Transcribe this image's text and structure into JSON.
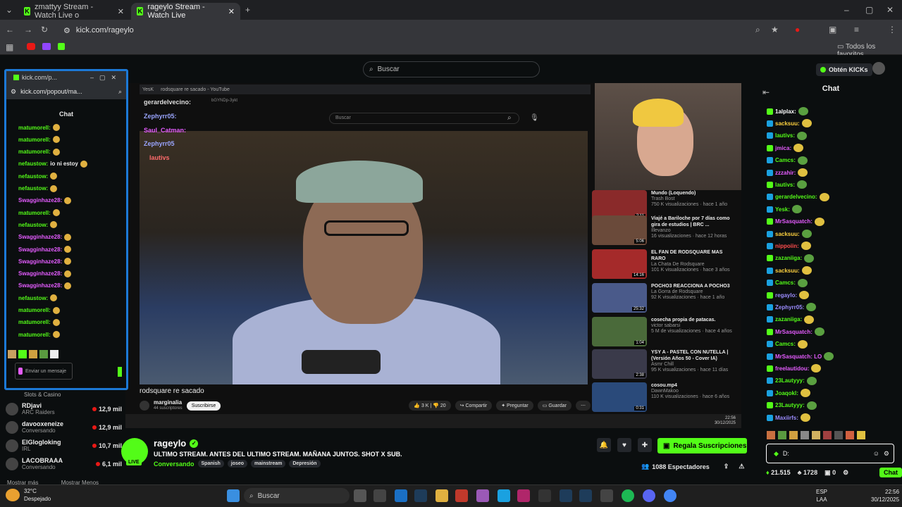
{
  "browser": {
    "tabs": [
      {
        "label": "zmattyy Stream - Watch Live o",
        "active": false
      },
      {
        "label": "rageylo Stream - Watch Live",
        "active": true
      }
    ],
    "url": "kick.com/rageylo",
    "bookmarks_label": "Todos los favoritos"
  },
  "kick": {
    "search_placeholder": "Buscar",
    "obtain_kicks": "Obtén KICKs",
    "chat_title": "Chat"
  },
  "popout": {
    "window_title": "kick.com/p...",
    "url": "kick.com/popout/ma...",
    "chat_label": "Chat",
    "input_placeholder": "Enviar un mensaje",
    "messages": [
      {
        "user": "matumorell:",
        "text": "",
        "color": "green"
      },
      {
        "user": "matumorell:",
        "text": "",
        "color": "green"
      },
      {
        "user": "matumorell:",
        "text": "",
        "color": "green"
      },
      {
        "user": "nefaustow:",
        "text": "io ni estoy",
        "color": "green"
      },
      {
        "user": "nefaustow:",
        "text": "",
        "color": "green"
      },
      {
        "user": "nefaustow:",
        "text": "",
        "color": "green"
      },
      {
        "user": "Swagginhaze28:",
        "text": "",
        "color": "pink"
      },
      {
        "user": "matumorell:",
        "text": "",
        "color": "green"
      },
      {
        "user": "nefaustow:",
        "text": "",
        "color": "green"
      },
      {
        "user": "Swagginhaze28:",
        "text": "",
        "color": "pink"
      },
      {
        "user": "Swagginhaze28:",
        "text": "",
        "color": "pink"
      },
      {
        "user": "Swagginhaze28:",
        "text": "",
        "color": "pink"
      },
      {
        "user": "Swagginhaze28:",
        "text": "",
        "color": "pink"
      },
      {
        "user": "Swagginhaze28:",
        "text": "",
        "color": "pink"
      },
      {
        "user": "nefaustow:",
        "text": "",
        "color": "green"
      },
      {
        "user": "matumorell:",
        "text": "",
        "color": "green"
      },
      {
        "user": "matumorell:",
        "text": "",
        "color": "green"
      },
      {
        "user": "matumorell:",
        "text": "",
        "color": "green"
      }
    ]
  },
  "sidebar": {
    "category": "Slots & Casino",
    "channels": [
      {
        "name": "RDjavi",
        "sub": "ARC Raiders",
        "count": "12,9 mil"
      },
      {
        "name": "davooxeneize",
        "sub": "Conversando",
        "count": "12,9 mil"
      },
      {
        "name": "ElGlogloking",
        "sub": "IRL",
        "count": "10,7 mil"
      },
      {
        "name": "LACOBRAAA",
        "sub": "Conversando",
        "count": "6,1 mil"
      }
    ],
    "show_more": "Mostrar más",
    "show_less": "Mostrar Menos"
  },
  "video": {
    "overlay_users": [
      "gerardelvecino:",
      "Zephyrr05:",
      "Saul_Catman:",
      "Zephyrr05",
      "lautivs"
    ],
    "yt_search": "Buscar",
    "yt_tabs": [
      "YesK",
      "rodsquare re sacado - YouTube"
    ],
    "yt_url": "bGYNDp-3ykt",
    "title": "rodsquare re sacado",
    "channel": "marginalia",
    "subs": "44 suscriptores",
    "subscribe": "Suscribirse",
    "likes": "3 K",
    "comments": "20",
    "share": "Compartir",
    "ask": "Preguntar",
    "save": "Guardar",
    "recommended": [
      {
        "title": "Mundo (Loquendo)",
        "channel": "Trash Bost",
        "meta": "750 K visualizaciones · hace 1 año",
        "dur": "2:11"
      },
      {
        "title": "Viajé a Bariloche por 7 días como gira de estudios | BRC ...",
        "channel": "Illevanzo",
        "meta": "16 visualizaciones · hace 12 horas",
        "dur": "5:06"
      },
      {
        "title": "EL FAN DE RODSQUARE MAS RARO",
        "channel": "La Chata De Rodsquare",
        "meta": "101 K visualizaciones · hace 3 años",
        "dur": "14:16"
      },
      {
        "title": "POCHO3 REACCIONA A POCHO3",
        "channel": "La Gorra de Rodsquare",
        "meta": "92 K visualizaciones · hace 1 año",
        "dur": "25:32"
      },
      {
        "title": "cosecha propia de patacas.",
        "channel": "victor sabarsi",
        "meta": "5 M de visualizaciones · hace 4 años",
        "dur": "1:04"
      },
      {
        "title": "YSY A - PASTEL CON NUTELLA | (Versión Años 50 - Cover IA)",
        "channel": "Asmr Chill",
        "meta": "95 K visualizaciones · hace 11 días",
        "dur": "2:38"
      },
      {
        "title": "cosou.mp4",
        "channel": "DawnMakoo",
        "meta": "110 K visualizaciones · hace 6 años",
        "dur": "0:31"
      }
    ],
    "inner_clock": "22:56",
    "inner_date": "30/12/2025"
  },
  "stream": {
    "name": "rageylo",
    "title": "ULTIMO STREAM. ANTES DEL ULTIMO STREAM. MAÑANA JUNTOS. SHOT X SUB.",
    "category": "Conversando",
    "tags": [
      "Spanish",
      "joseo",
      "mainstream",
      "Depresión"
    ],
    "live": "LIVE",
    "gift_button": "Regala Suscripciones",
    "viewers": "1088 Espectadores"
  },
  "chat": {
    "messages": [
      {
        "user": "1alplax:",
        "color": "#ffffff"
      },
      {
        "user": "sacksuu:",
        "color": "#ffd23f"
      },
      {
        "user": "lautivs:",
        "color": "#53fc18"
      },
      {
        "user": "jmica:",
        "color": "#e55cff"
      },
      {
        "user": "Camcs:",
        "color": "#53fc18"
      },
      {
        "user": "zzzahir:",
        "color": "#e55cff"
      },
      {
        "user": "lautivs:",
        "color": "#53fc18"
      },
      {
        "user": "gerardelvecino:",
        "color": "#53fc18"
      },
      {
        "user": "Yesk:",
        "color": "#53fc18"
      },
      {
        "user": "MrSasquatch:",
        "color": "#e55cff"
      },
      {
        "user": "sacksuu:",
        "color": "#ffd23f"
      },
      {
        "user": "nippoiin:",
        "color": "#ff4d4d"
      },
      {
        "user": "zazaniiga:",
        "color": "#53fc18"
      },
      {
        "user": "sacksuu:",
        "color": "#ffd23f"
      },
      {
        "user": "Camcs:",
        "color": "#53fc18"
      },
      {
        "user": "regaylo:",
        "color": "#9b8cff"
      },
      {
        "user": "Zephyrr05:",
        "color": "#9b8cff"
      },
      {
        "user": "zazaniiga:",
        "color": "#53fc18"
      },
      {
        "user": "MrSasquatch:",
        "color": "#e55cff"
      },
      {
        "user": "Camcs:",
        "color": "#53fc18"
      },
      {
        "user": "MrSasquatch: LO",
        "color": "#e55cff"
      },
      {
        "user": "freelautidou:",
        "color": "#e55cff"
      },
      {
        "user": "23Lautyyy:",
        "color": "#53fc18"
      },
      {
        "user": "Joaqokl:",
        "color": "#53fc18"
      },
      {
        "user": "23Lautyyy:",
        "color": "#53fc18"
      },
      {
        "user": "Maxiirfs:",
        "color": "#9b8cff"
      }
    ],
    "input_text": "D:",
    "points": "21.515",
    "count2": "1728",
    "count3": "0",
    "chat_btn": "Chat"
  },
  "taskbar": {
    "temp": "32°C",
    "weather": "Despejado",
    "search": "Buscar",
    "lang1": "ESP",
    "lang2": "LAA",
    "time": "22:56",
    "date": "30/12/2025"
  },
  "colors": {
    "kick_green": "#53fc18",
    "bg": "#0b0e0f",
    "popout_border": "#1c79d6"
  }
}
